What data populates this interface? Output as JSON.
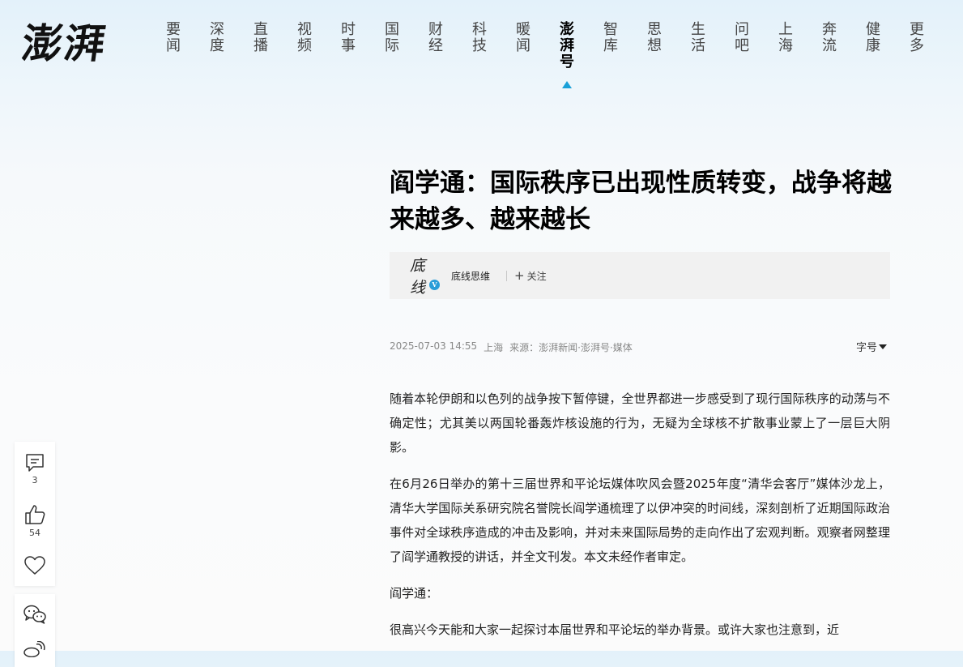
{
  "brand": {
    "logo_text": "澎湃"
  },
  "nav": {
    "items": [
      {
        "label": "要闻",
        "active": false
      },
      {
        "label": "深度",
        "active": false
      },
      {
        "label": "直播",
        "active": false
      },
      {
        "label": "视频",
        "active": false
      },
      {
        "label": "时事",
        "active": false
      },
      {
        "label": "国际",
        "active": false
      },
      {
        "label": "财经",
        "active": false
      },
      {
        "label": "科技",
        "active": false
      },
      {
        "label": "暖闻",
        "active": false
      },
      {
        "label": "澎湃号",
        "active": true
      },
      {
        "label": "智库",
        "active": false
      },
      {
        "label": "思想",
        "active": false
      },
      {
        "label": "生活",
        "active": false
      },
      {
        "label": "问吧",
        "active": false
      },
      {
        "label": "上海",
        "active": false
      },
      {
        "label": "奔流",
        "active": false
      },
      {
        "label": "健康",
        "active": false
      },
      {
        "label": "更多",
        "active": false
      }
    ],
    "active_color": "#19a0d8"
  },
  "article": {
    "title": "阎学通：国际秩序已出现性质转变，战争将越来越多、越来越长",
    "author": {
      "name": "底线思维",
      "avatar_text": "底线",
      "verified_mark": "V",
      "follow_label": "关注"
    },
    "meta": {
      "datetime": "2025-07-03 14:55",
      "location": "上海",
      "source": "来源：澎湃新闻·澎湃号·媒体"
    },
    "font_size_label": "字号",
    "paragraphs": [
      "随着本轮伊朗和以色列的战争按下暂停键，全世界都进一步感受到了现行国际秩序的动荡与不确定性；尤其美以两国轮番轰炸核设施的行为，无疑为全球核不扩散事业蒙上了一层巨大阴影。",
      "在6月26日举办的第十三届世界和平论坛媒体吹风会暨2025年度“清华会客厅”媒体沙龙上，清华大学国际关系研究院名誉院长阎学通梳理了以伊冲突的时间线，深刻剖析了近期国际政治事件对全球秩序造成的冲击及影响，并对未来国际局势的走向作出了宏观判断。观察者网整理了阎学通教授的讲话，并全文刊发。本文未经作者审定。",
      "阎学通：",
      "很高兴今天能和大家一起探讨本届世界和平论坛的举办背景。或许大家也注意到，近"
    ]
  },
  "sidebar": {
    "comment_count": "3",
    "like_count": "54"
  }
}
